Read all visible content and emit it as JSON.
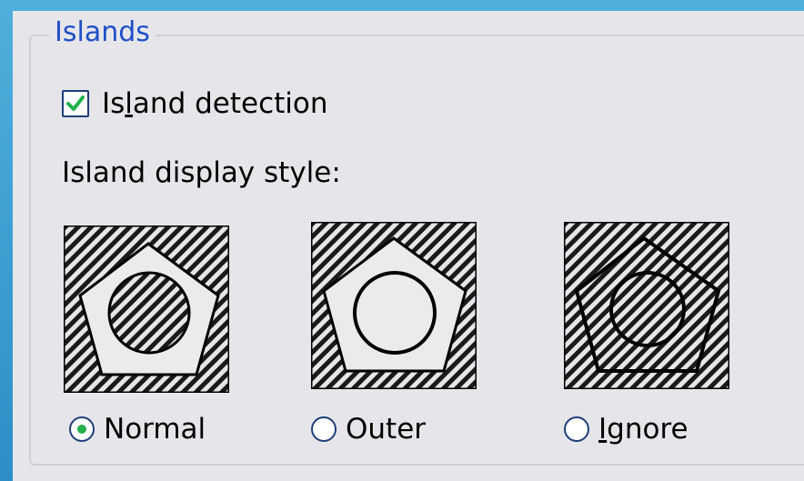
{
  "group": {
    "title": "Islands"
  },
  "island_detection": {
    "label_pre": "Is",
    "label_mnemonic": "l",
    "label_post": "and detection",
    "checked": true
  },
  "display_style": {
    "label": "Island display style:",
    "options": [
      {
        "label": "Normal",
        "selected": true
      },
      {
        "label_mnemonic": "I",
        "label_post": "gnore"
      }
    ],
    "outer_label": "Outer"
  },
  "colors": {
    "accent": "#1f4ec8",
    "check": "#22b14c",
    "background": "#e6e6ea",
    "frame": "#2c8fc6"
  }
}
